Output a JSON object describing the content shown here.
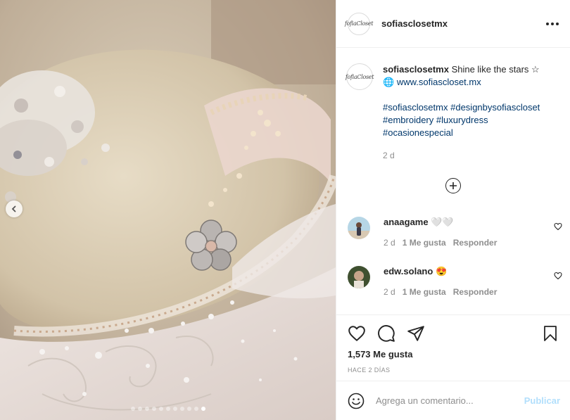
{
  "post": {
    "username": "sofiasclosetmx",
    "avatar_logo_text": "fofiaCloset",
    "more_icon": "more-horizontal-icon",
    "caption": {
      "username": "sofiasclosetmx",
      "text": "Shine like the stars ☆",
      "link_icon": "globe-emoji",
      "link_globe": "🌐",
      "link": "www.sofiascloset.mx",
      "hashtags": [
        "#sofiasclosetmx",
        "#designbysofiascloset",
        "#embroidery",
        "#luxurydress",
        "#ocasionespecial"
      ],
      "age": "2 d"
    },
    "load_more_icon": "plus-circle-icon",
    "comments": [
      {
        "username": "anaagame",
        "text": "🤍🤍",
        "age": "2 d",
        "likes": "1 Me gusta",
        "reply": "Responder"
      },
      {
        "username": "edw.solano",
        "text": "😍",
        "age": "2 d",
        "likes": "1 Me gusta",
        "reply": "Responder"
      }
    ],
    "likes": "1,573 Me gusta",
    "posted": "HACE 2 DÍAS",
    "add_comment": {
      "placeholder": "Agrega un comentario...",
      "publish": "Publicar",
      "emoji_icon": "smiley-icon"
    },
    "carousel": {
      "total": 11,
      "active_index": 10
    },
    "colors": {
      "link": "#00376b",
      "muted": "#8e8e8e",
      "publish_disabled": "#b2dffc"
    }
  }
}
